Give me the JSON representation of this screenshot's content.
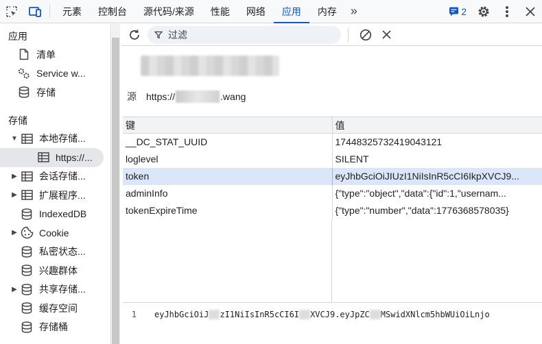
{
  "tabs": [
    "元素",
    "控制台",
    "源代码/来源",
    "性能",
    "网络",
    "应用",
    "内存"
  ],
  "active_tab": "应用",
  "more_tabs_label": "»",
  "issues_count": "2",
  "sidebar": {
    "app_section": "应用",
    "app_items": [
      "清单",
      "Service w...",
      "存储"
    ],
    "storage_section": "存储",
    "storage_items": [
      {
        "label": "本地存储...",
        "arrow": "down",
        "icon": "table-icon"
      },
      {
        "label": "https://...",
        "arrow": "",
        "icon": "table-icon",
        "selected": true
      },
      {
        "label": "会话存储...",
        "arrow": "right",
        "icon": "table-icon"
      },
      {
        "label": "扩展程序...",
        "arrow": "right",
        "icon": "table-icon"
      },
      {
        "label": "IndexedDB",
        "arrow": "",
        "icon": "database-icon"
      },
      {
        "label": "Cookie",
        "arrow": "right",
        "icon": "cookie-icon"
      },
      {
        "label": "私密状态...",
        "arrow": "",
        "icon": "database-icon"
      },
      {
        "label": "兴趣群体",
        "arrow": "",
        "icon": "database-icon"
      },
      {
        "label": "共享存储...",
        "arrow": "right",
        "icon": "database-icon"
      },
      {
        "label": "缓存空间",
        "arrow": "",
        "icon": "database-icon"
      },
      {
        "label": "存储桶",
        "arrow": "",
        "icon": "database-icon"
      }
    ]
  },
  "filter": {
    "placeholder": "过滤"
  },
  "origin": {
    "label": "源",
    "prefix": "https://",
    "suffix": ".wang"
  },
  "table": {
    "headers": [
      "键",
      "值"
    ],
    "rows": [
      {
        "key": "__DC_STAT_UUID",
        "value": "17448325732419043121"
      },
      {
        "key": "loglevel",
        "value": "SILENT"
      },
      {
        "key": "token",
        "value": "eyJhbGciOiJIUzI1NiIsInR5cCI6IkpXVCJ9...",
        "selected": true
      },
      {
        "key": "adminInfo",
        "value": "{\"type\":\"object\",\"data\":{\"id\":1,\"usernam..."
      },
      {
        "key": "tokenExpireTime",
        "value": "{\"type\":\"number\",\"data\":1776368578035}"
      }
    ]
  },
  "preview": {
    "line_number": "1",
    "parts": [
      "eyJhbGciOiJ",
      "zI1NiIsInR5cCI6I",
      "XVCJ9.eyJpZC",
      "MSwidXNlcm5hbWUiOiLnjo"
    ]
  }
}
